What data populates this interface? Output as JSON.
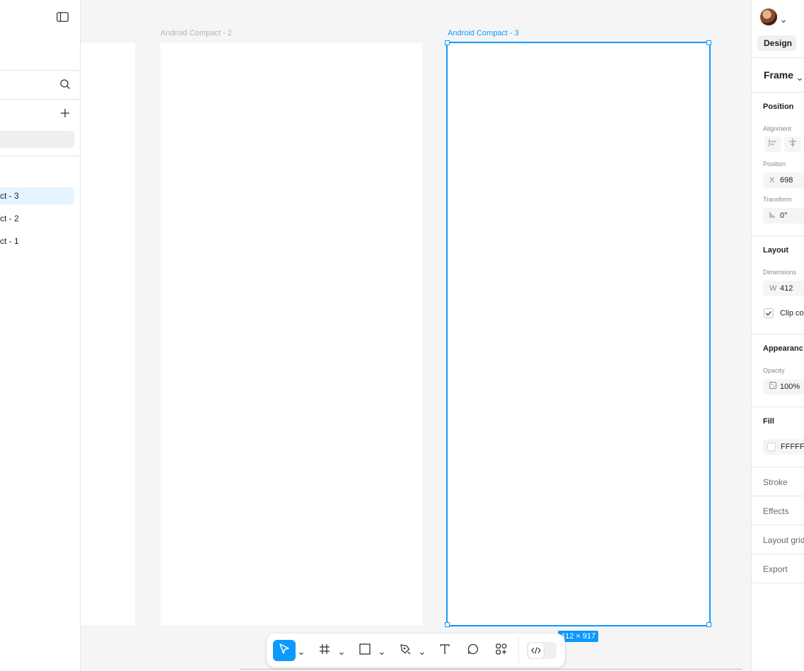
{
  "colors": {
    "accent": "#0d99ff",
    "canvas": "#f5f5f5",
    "frame": "#ffffff",
    "panel": "#ffffff"
  },
  "layers_panel": {
    "toggle_icon": "sidebar-toggle-icon",
    "search_icon": "search-icon",
    "add_page_icon": "plus-icon",
    "layers": [
      {
        "label": "ct - 3",
        "selected": true
      },
      {
        "label": "ct - 2",
        "selected": false
      },
      {
        "label": "ct - 1",
        "selected": false
      }
    ]
  },
  "canvas": {
    "frames": [
      {
        "name": "Android Compact - 2",
        "selected": false
      },
      {
        "name": "Android Compact - 3",
        "selected": true
      }
    ],
    "selection_size": "412 × 917"
  },
  "toolbar": {
    "tools": [
      "move-icon",
      "frame-icon",
      "rectangle-icon",
      "pen-icon",
      "text-icon",
      "comment-icon",
      "actions-icon"
    ],
    "active_tool": "move",
    "dev_mode_icon": "code-icon"
  },
  "properties": {
    "design_tab": "Design",
    "frame_label": "Frame",
    "position_section": "Position",
    "alignment_label": "Alignment",
    "position_label": "Position",
    "x_prefix": "X",
    "x_value": "698",
    "transform_label": "Transform",
    "rotation_value": "0°",
    "layout_section": "Layout",
    "dimensions_label": "Dimensions",
    "w_prefix": "W",
    "w_value": "412",
    "clip_content_label": "Clip co",
    "clip_content_checked": true,
    "appearance_section": "Appearanc",
    "opacity_label": "Opacity",
    "opacity_value": "100%",
    "fill_section": "Fill",
    "fill_value": "FFFFF",
    "stroke_label": "Stroke",
    "effects_label": "Effects",
    "layout_grid_label": "Layout grid",
    "export_label": "Export"
  }
}
